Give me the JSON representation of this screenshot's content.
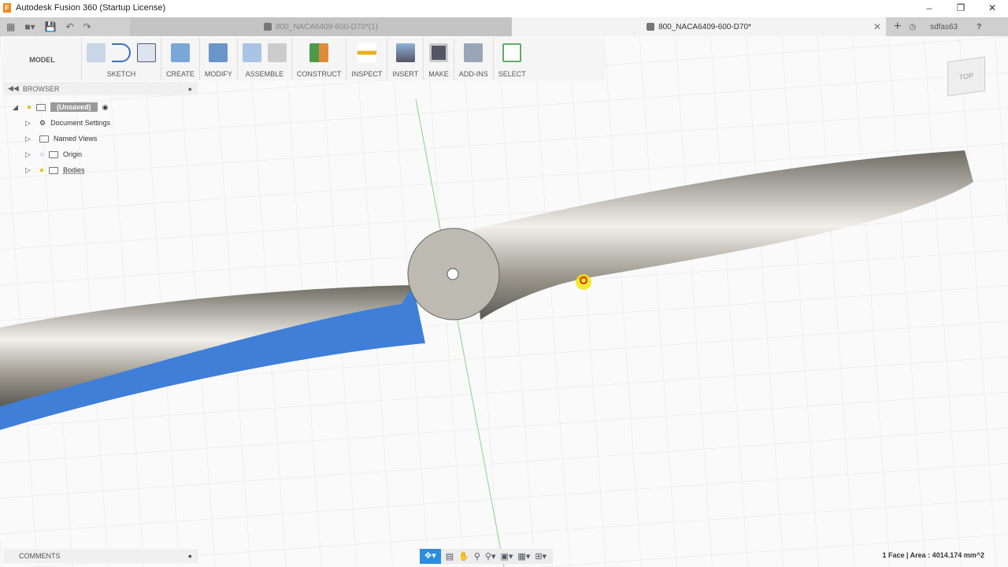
{
  "window": {
    "title": "Autodesk Fusion 360 (Startup License)",
    "controls": [
      "minimize",
      "restore",
      "close"
    ]
  },
  "tabs": [
    {
      "label": "800_NACA6409-600-D70*(1)",
      "active": false
    },
    {
      "label": "800_NACA6409-600-D70*",
      "active": true
    }
  ],
  "user": "sdfas63",
  "toolbar": {
    "workspace": "MODEL",
    "groups": [
      "SKETCH",
      "CREATE",
      "MODIFY",
      "ASSEMBLE",
      "CONSTRUCT",
      "INSPECT",
      "INSERT",
      "MAKE",
      "ADD-INS",
      "SELECT"
    ]
  },
  "browser": {
    "title": "BROWSER",
    "root": "(Unsaved)",
    "items": [
      "Document Settings",
      "Named Views",
      "Origin",
      "Bodies"
    ]
  },
  "comments": "COMMENTS",
  "viewcube": "TOP",
  "status": "1 Face | Area : 4014.174 mm^2",
  "colors": {
    "selection": "#3f7fd8",
    "accent": "#2a8ee0"
  }
}
